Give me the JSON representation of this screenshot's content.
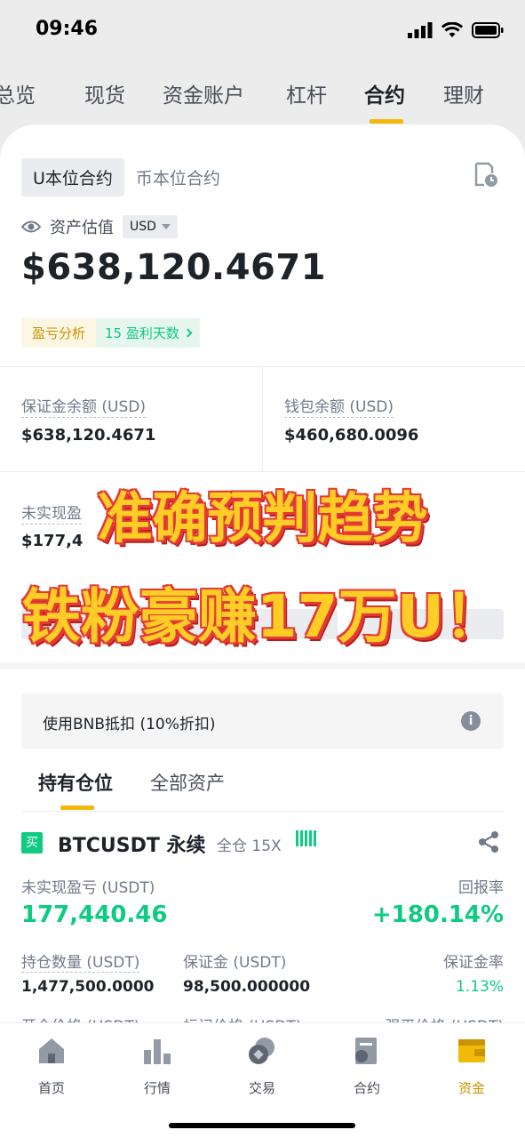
{
  "status_bar": {
    "time": "09:46"
  },
  "top_tabs": [
    {
      "label": "总览"
    },
    {
      "label": "现货"
    },
    {
      "label": "资金账户"
    },
    {
      "label": "杠杆"
    },
    {
      "label": "合约"
    },
    {
      "label": "理财"
    }
  ],
  "segment": {
    "usdm": "U本位合约",
    "coinm": "币本位合约"
  },
  "asset": {
    "label": "资产估值",
    "currency": "USD",
    "value": "$638,120.4671"
  },
  "pnl": {
    "analysis": "盈亏分析",
    "profit_days": "15 盈利天数"
  },
  "balances": {
    "margin_label": "保证金余额 (USD)",
    "margin_value": "$638,120.4671",
    "wallet_label": "钱包余额 (USD)",
    "wallet_value": "$460,680.0096",
    "unrealized_label": "未实现盈",
    "unrealized_value": "$177,4"
  },
  "overlay": {
    "line1": "准确预判趋势",
    "line2": "铁粉豪赚17万U！"
  },
  "bnb": {
    "text": "使用BNB抵扣 (10%折扣)",
    "info": "i"
  },
  "sub_tabs": {
    "positions": "持有仓位",
    "all_assets": "全部资产"
  },
  "position": {
    "side": "买",
    "symbol": "BTCUSDT 永续",
    "margin_mode": "全仓 15X",
    "unrealized_label": "未实现盈亏 (USDT)",
    "unrealized_value": "177,440.46",
    "roe_label": "回报率",
    "roe_value": "+180.14%",
    "size_label": "持仓数量 (USDT)",
    "size_value": "1,477,500.0000",
    "margin_label": "保证金 (USDT)",
    "margin_value": "98,500.000000",
    "margin_ratio_label": "保证金率",
    "margin_ratio_value": "1.13%",
    "entry_label": "开仓价格 (USDT)",
    "mark_label": "标记价格 (USDT)",
    "liq_label": "强平价格 (USDT)"
  },
  "tabbar": [
    {
      "label": "首页",
      "icon": "home-icon"
    },
    {
      "label": "行情",
      "icon": "markets-icon"
    },
    {
      "label": "交易",
      "icon": "trade-icon"
    },
    {
      "label": "合约",
      "icon": "futures-icon"
    },
    {
      "label": "资金",
      "icon": "wallet-icon"
    }
  ],
  "colors": {
    "accent": "#f0b90b",
    "green": "#0ecb81",
    "text": "#1e2329",
    "muted": "#707a8a"
  }
}
